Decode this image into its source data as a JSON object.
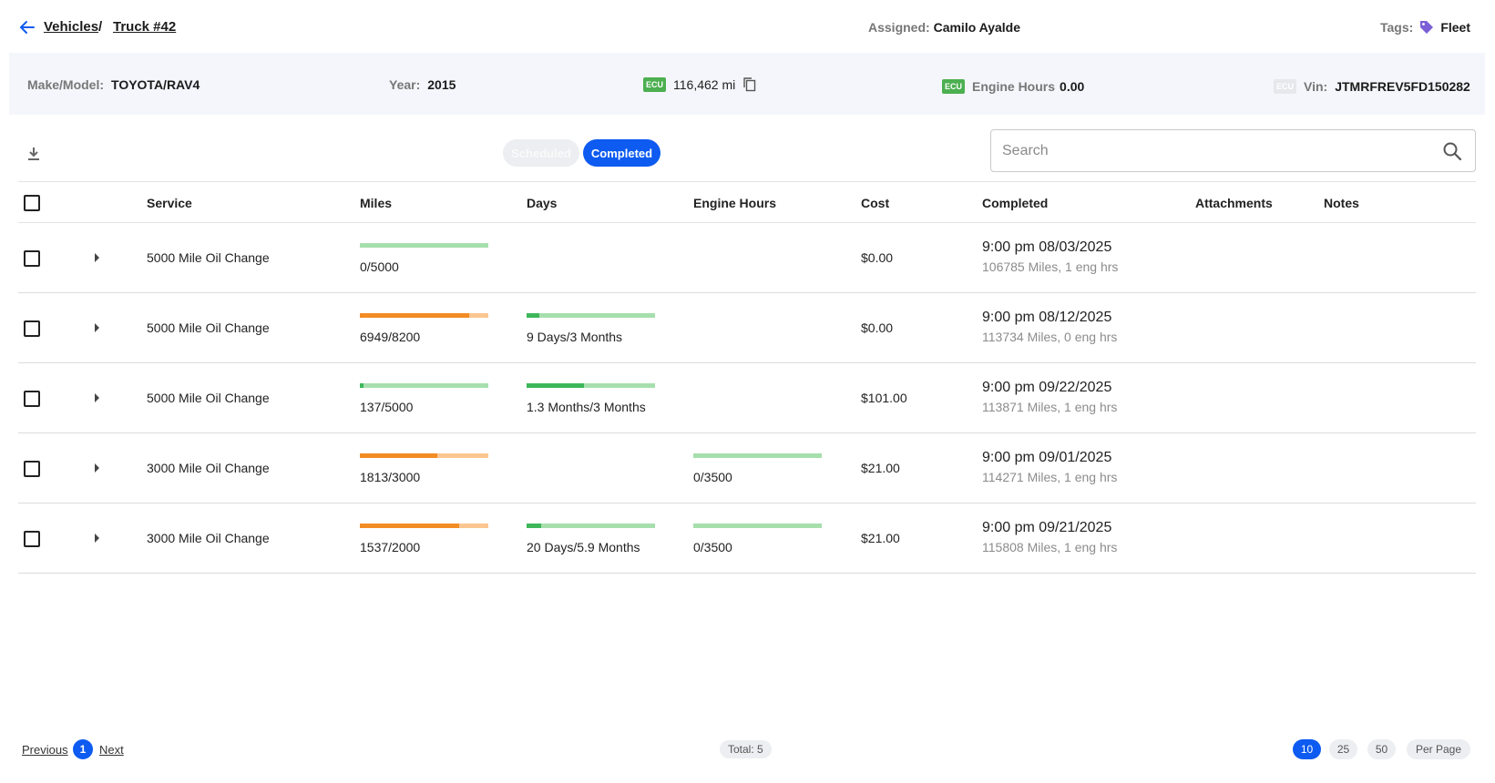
{
  "breadcrumb": {
    "parent": "Vehicles",
    "sep": "/",
    "current": "Truck #42"
  },
  "assigned": {
    "label": "Assigned:",
    "value": "Camilo Ayalde"
  },
  "tags": {
    "label": "Tags:",
    "value": "Fleet",
    "color": "#7b5fd6"
  },
  "info": {
    "make_label": "Make/Model:",
    "make_value": "TOYOTA/RAV4",
    "year_label": "Year:",
    "year_value": "2015",
    "ecu_badge": "ECU",
    "odometer": "116,462 mi",
    "engine_label": "Engine Hours",
    "engine_value": "0.00",
    "vin_label": "Vin:",
    "vin_value": "JTMRFREV5FD150282"
  },
  "tabs": {
    "scheduled": "Scheduled",
    "completed": "Completed"
  },
  "search": {
    "placeholder": "Search"
  },
  "columns": {
    "service": "Service",
    "miles": "Miles",
    "days": "Days",
    "engine_hours": "Engine Hours",
    "cost": "Cost",
    "completed": "Completed",
    "attachments": "Attachments",
    "notes": "Notes"
  },
  "rows": [
    {
      "service": "5000 Mile Oil Change",
      "miles": {
        "text": "0/5000",
        "fraction": 0.0,
        "color": "green"
      },
      "days": null,
      "engine": null,
      "cost": "$0.00",
      "completed_date": "9:00 pm 08/03/2025",
      "completed_sub": "106785 Miles, 1 eng hrs"
    },
    {
      "service": "5000 Mile Oil Change",
      "miles": {
        "text": "6949/8200",
        "fraction": 0.85,
        "color": "orange"
      },
      "days": {
        "text": "9 Days/3 Months",
        "fraction": 0.1,
        "color": "green"
      },
      "engine": null,
      "cost": "$0.00",
      "completed_date": "9:00 pm 08/12/2025",
      "completed_sub": "113734 Miles, 0 eng hrs"
    },
    {
      "service": "5000 Mile Oil Change",
      "miles": {
        "text": "137/5000",
        "fraction": 0.03,
        "color": "green"
      },
      "days": {
        "text": "1.3 Months/3 Months",
        "fraction": 0.45,
        "color": "green"
      },
      "engine": null,
      "cost": "$101.00",
      "completed_date": "9:00 pm 09/22/2025",
      "completed_sub": "113871 Miles, 1 eng hrs"
    },
    {
      "service": "3000 Mile Oil Change",
      "miles": {
        "text": "1813/3000",
        "fraction": 0.6,
        "color": "orange"
      },
      "days": null,
      "engine": {
        "text": "0/3500",
        "fraction": 0.0,
        "color": "green"
      },
      "cost": "$21.00",
      "completed_date": "9:00 pm 09/01/2025",
      "completed_sub": "114271 Miles, 1 eng hrs"
    },
    {
      "service": "3000 Mile Oil Change",
      "miles": {
        "text": "1537/2000",
        "fraction": 0.77,
        "color": "orange"
      },
      "days": {
        "text": "20 Days/5.9 Months",
        "fraction": 0.11,
        "color": "green"
      },
      "engine": {
        "text": "0/3500",
        "fraction": 0.0,
        "color": "green"
      },
      "cost": "$21.00",
      "completed_date": "9:00 pm 09/21/2025",
      "completed_sub": "115808 Miles, 1 eng hrs"
    }
  ],
  "pagination": {
    "previous": "Previous",
    "current_page": "1",
    "next": "Next",
    "total": "Total: 5",
    "per_page_options": [
      "10",
      "25",
      "50"
    ],
    "per_page_selected": "10",
    "per_page_label": "Per Page"
  },
  "colors": {
    "accent": "#0d5bf0",
    "ecu_green": "#4caf50"
  }
}
